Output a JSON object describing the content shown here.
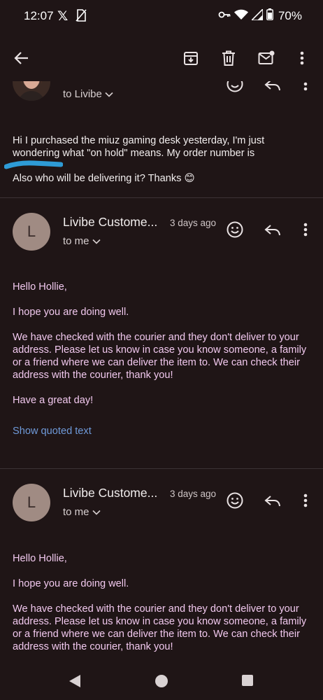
{
  "status_bar": {
    "time": "12:07",
    "battery": "70%",
    "icons": [
      "x-app-icon",
      "no-sim-icon",
      "vpn-key-icon",
      "wifi-icon",
      "signal-icon",
      "battery-icon"
    ]
  },
  "app_bar": {
    "icons": [
      "back-arrow-icon",
      "archive-icon",
      "delete-icon",
      "mark-unread-icon",
      "more-vert-icon"
    ]
  },
  "previous_message": {
    "to_line": "to Livibe",
    "body_line1": "Hi I purchased the miuz gaming desk yesterday, I'm just",
    "body_line2": "wondering what \"on hold\" means. My order number is",
    "body_line3": "Also who will be delivering it? Thanks 😊"
  },
  "messages": [
    {
      "avatar_letter": "L",
      "sender": "Livibe Custome...",
      "date": "3 days ago",
      "to_line": "to me",
      "greeting": "Hello Hollie,",
      "line1": "I hope you are doing well.",
      "paragraph": "We have checked with the courier and they don't deliver to your address. Please let us know in case you know someone, a family or a friend where we can deliver the item to. We can check their address with the courier, thank you!",
      "closing": "Have a great day!",
      "show_quoted": "Show quoted text"
    },
    {
      "avatar_letter": "L",
      "sender": "Livibe Custome...",
      "date": "3 days ago",
      "to_line": "to me",
      "greeting": "Hello Hollie,",
      "line1": "I hope you are doing well.",
      "paragraph": "We have checked with the courier and they don't deliver to your address. Please let us know in case you know someone, a family or a friend where we can deliver the item to. We can check their address with the courier, thank you!"
    }
  ],
  "colors": {
    "background": "#1f1516",
    "body_text": "#f1c8ee",
    "link": "#6f9ad9",
    "avatar": "#a08b83"
  }
}
